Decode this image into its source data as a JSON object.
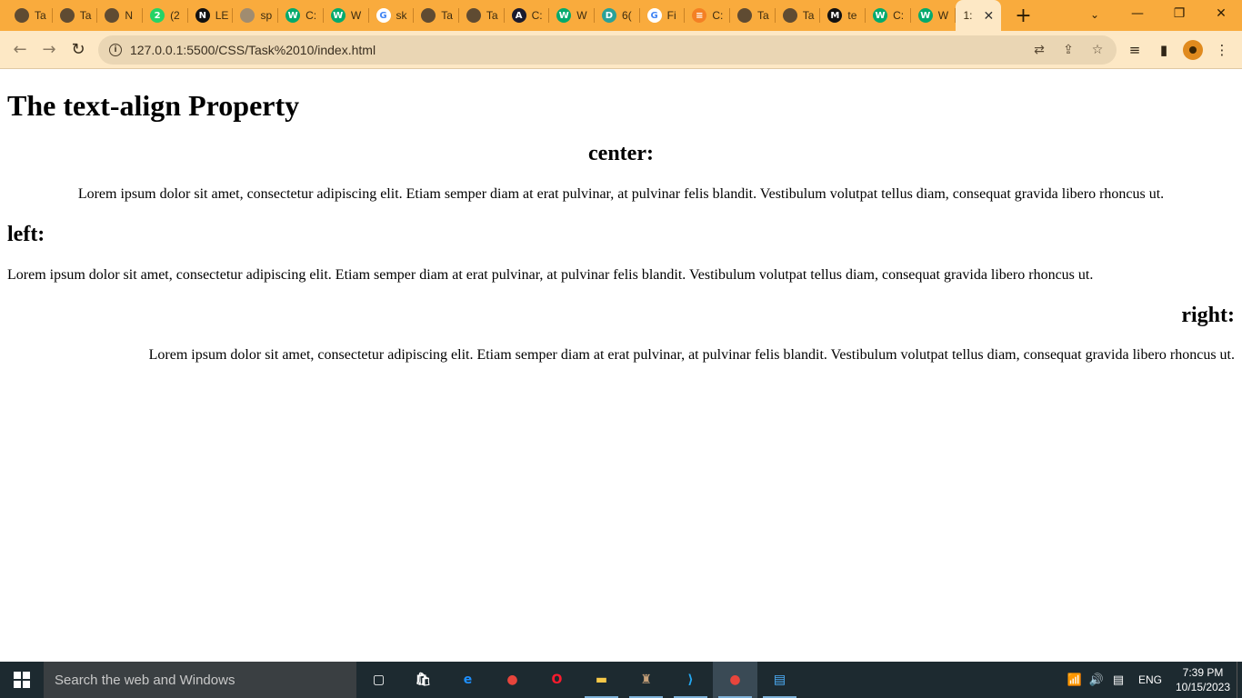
{
  "browser": {
    "tabs": [
      {
        "title": "Ta",
        "icon": "globe-icon",
        "color": "#5f4b32"
      },
      {
        "title": "Ta",
        "icon": "globe-icon",
        "color": "#5f4b32"
      },
      {
        "title": "N",
        "icon": "chrome-icon",
        "color": "#5f4b32"
      },
      {
        "title": "(2",
        "icon": "whatsapp-icon",
        "color": "#25d366",
        "glyph": "2"
      },
      {
        "title": "LE",
        "icon": "notion-icon",
        "color": "#111111",
        "glyph": "N"
      },
      {
        "title": "sp",
        "icon": "globe-icon",
        "color": "#a08c70"
      },
      {
        "title": "C:",
        "icon": "w3schools-icon",
        "color": "#04aa6d",
        "glyph": "W"
      },
      {
        "title": "W",
        "icon": "w3schools-icon",
        "color": "#04aa6d",
        "glyph": "W"
      },
      {
        "title": "sk",
        "icon": "google-icon",
        "color": "#ffffff",
        "glyph": "G"
      },
      {
        "title": "Ta",
        "icon": "globe-icon",
        "color": "#5f4b32"
      },
      {
        "title": "Ta",
        "icon": "globe-icon",
        "color": "#5f4b32"
      },
      {
        "title": "C:",
        "icon": "codewars-icon",
        "color": "#1b1b2e",
        "glyph": "A"
      },
      {
        "title": "W",
        "icon": "w3schools-icon",
        "color": "#04aa6d",
        "glyph": "W"
      },
      {
        "title": "6(",
        "icon": "dotnet-icon",
        "color": "#2aa198",
        "glyph": "D"
      },
      {
        "title": "Fi",
        "icon": "google-icon",
        "color": "#ffffff",
        "glyph": "G"
      },
      {
        "title": "C:",
        "icon": "stackoverflow-icon",
        "color": "#f48024",
        "glyph": "≡"
      },
      {
        "title": "Ta",
        "icon": "globe-icon",
        "color": "#5f4b32"
      },
      {
        "title": "Ta",
        "icon": "globe-icon",
        "color": "#5f4b32"
      },
      {
        "title": "te",
        "icon": "medium-icon",
        "color": "#111111",
        "glyph": "M"
      },
      {
        "title": "C:",
        "icon": "w3schools-icon",
        "color": "#04aa6d",
        "glyph": "W"
      },
      {
        "title": "W",
        "icon": "w3schools-icon",
        "color": "#04aa6d",
        "glyph": "W"
      }
    ],
    "active_tab": {
      "title": "1:",
      "close": "✕"
    },
    "new_tab": "+",
    "window": {
      "minimize": "—",
      "restore": "❐",
      "close": "✕",
      "tab_search": "⌄"
    },
    "nav": {
      "back": "←",
      "forward": "→",
      "reload": "↻"
    },
    "url": "127.0.0.1:5500/CSS/Task%2010/index.html",
    "omnibox_icons": {
      "translate": "⇄",
      "share": "⇪",
      "bookmark": "☆"
    },
    "tools": {
      "reading_list": "≡",
      "side_panel": "▮",
      "menu": "⋮"
    },
    "accent_color": "#f9ab3d"
  },
  "page": {
    "title": "The text-align Property",
    "sections": [
      {
        "heading": "center:",
        "text": "Lorem ipsum dolor sit amet, consectetur adipiscing elit. Etiam semper diam at erat pulvinar, at pulvinar felis blandit. Vestibulum volutpat tellus diam, consequat gravida libero rhoncus ut."
      },
      {
        "heading": "left:",
        "text": "Lorem ipsum dolor sit amet, consectetur adipiscing elit. Etiam semper diam at erat pulvinar, at pulvinar felis blandit. Vestibulum volutpat tellus diam, consequat gravida libero rhoncus ut."
      },
      {
        "heading": "right:",
        "text": "Lorem ipsum dolor sit amet, consectetur adipiscing elit. Etiam semper diam at erat pulvinar, at pulvinar felis blandit. Vestibulum volutpat tellus diam, consequat gravida libero rhoncus ut."
      }
    ]
  },
  "taskbar": {
    "search_placeholder": "Search the web and Windows",
    "apps": [
      {
        "name": "task-view-icon",
        "glyph": "▢",
        "color": "#ffffff"
      },
      {
        "name": "store-icon",
        "glyph": "🛍",
        "color": "#ffffff"
      },
      {
        "name": "edge-icon",
        "glyph": "e",
        "color": "#1e90ff"
      },
      {
        "name": "chrome-icon",
        "glyph": "●",
        "color": "#e8453c"
      },
      {
        "name": "opera-icon",
        "glyph": "O",
        "color": "#ff1b2d"
      },
      {
        "name": "file-explorer-icon",
        "glyph": "▬",
        "color": "#f7c948"
      },
      {
        "name": "game-icon",
        "glyph": "♜",
        "color": "#c9a27a"
      },
      {
        "name": "vscode-icon",
        "glyph": "⟩",
        "color": "#23a8f2"
      },
      {
        "name": "chrome-profile-icon",
        "glyph": "●",
        "color": "#e8453c"
      },
      {
        "name": "control-panel-icon",
        "glyph": "▤",
        "color": "#4fb3ff"
      }
    ],
    "tray": {
      "network": "📶",
      "volume": "🔊",
      "notifications": "▤",
      "language": "ENG"
    },
    "time": "7:39 PM",
    "date": "10/15/2023"
  }
}
